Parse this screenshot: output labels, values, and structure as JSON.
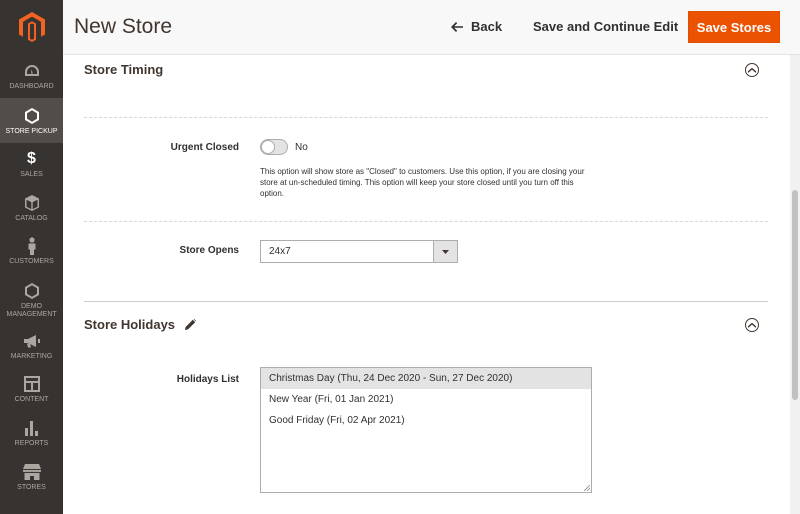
{
  "header": {
    "title": "New Store",
    "back_label": "Back",
    "save_continue_label": "Save and Continue Edit",
    "save_label": "Save Stores"
  },
  "sidebar": {
    "items": [
      {
        "label": "DASHBOARD",
        "icon": "dashboard-icon"
      },
      {
        "label": "STORE PICKUP",
        "icon": "hexagon-icon",
        "active": true
      },
      {
        "label": "SALES",
        "icon": "dollar-icon"
      },
      {
        "label": "CATALOG",
        "icon": "cube-icon"
      },
      {
        "label": "CUSTOMERS",
        "icon": "person-icon"
      },
      {
        "label": "DEMO MANAGEMENT",
        "icon": "hexagon-icon"
      },
      {
        "label": "MARKETING",
        "icon": "megaphone-icon"
      },
      {
        "label": "CONTENT",
        "icon": "layout-icon"
      },
      {
        "label": "REPORTS",
        "icon": "bar-chart-icon"
      },
      {
        "label": "STORES",
        "icon": "store-icon"
      }
    ]
  },
  "store_timing": {
    "title": "Store Timing",
    "urgent_closed_label": "Urgent Closed",
    "urgent_closed_value": "No",
    "urgent_closed_note": "This option will show store as \"Closed\" to customers. Use this option, if you are closing your store at un-scheduled timing. This option will keep your store closed until you turn off this option.",
    "store_opens_label": "Store Opens",
    "store_opens_value": "24x7"
  },
  "store_holidays": {
    "title": "Store Holidays",
    "holidays_list_label": "Holidays List",
    "holidays": [
      "Christmas Day (Thu, 24 Dec 2020 - Sun, 27 Dec 2020)",
      "New Year (Fri, 01 Jan 2021)",
      "Good Friday (Fri, 02 Apr 2021)"
    ]
  },
  "colors": {
    "sidebar_bg": "#373330",
    "accent": "#eb5202",
    "logo": "#f26322"
  }
}
